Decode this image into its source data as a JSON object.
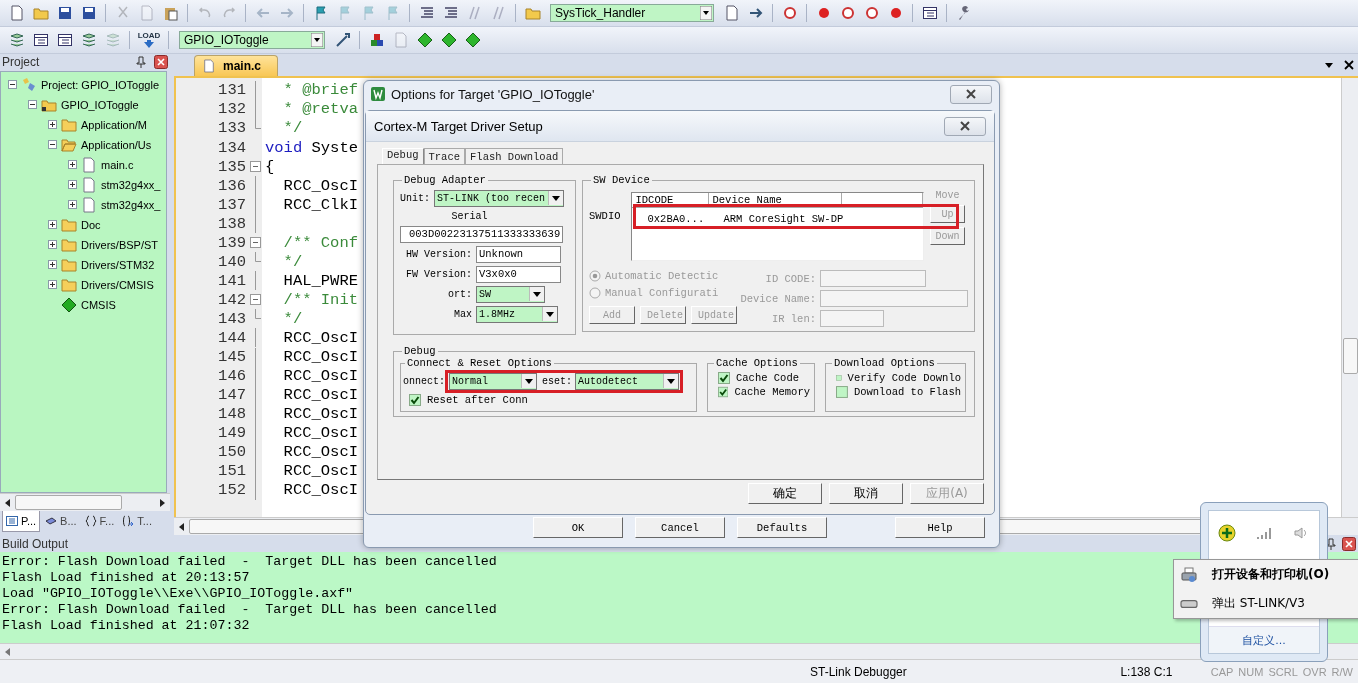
{
  "toolbar": {
    "function_combo": {
      "value": "SysTick_Handler"
    },
    "target_combo": {
      "value": "GPIO_IOToggle"
    },
    "load_label": "LOAD"
  },
  "project_panel": {
    "title": "Project",
    "tree": [
      {
        "label": "Project: GPIO_IOToggle",
        "kind": "project",
        "expanded": true,
        "children": [
          {
            "label": "GPIO_IOToggle",
            "kind": "target",
            "expanded": true,
            "children": [
              {
                "label": "Application/M",
                "kind": "group",
                "expanded": false
              },
              {
                "label": "Application/Us",
                "kind": "group",
                "expanded": true,
                "children": [
                  {
                    "label": "main.c",
                    "kind": "file",
                    "expanded": false
                  },
                  {
                    "label": "stm32g4xx_",
                    "kind": "file",
                    "expanded": false
                  },
                  {
                    "label": "stm32g4xx_",
                    "kind": "file",
                    "expanded": false
                  }
                ]
              },
              {
                "label": "Doc",
                "kind": "group",
                "expanded": false
              },
              {
                "label": "Drivers/BSP/ST",
                "kind": "group",
                "expanded": false
              },
              {
                "label": "Drivers/STM32",
                "kind": "group",
                "expanded": false
              },
              {
                "label": "Drivers/CMSIS",
                "kind": "group",
                "expanded": false
              },
              {
                "label": "CMSIS",
                "kind": "component"
              }
            ]
          }
        ]
      }
    ],
    "tabs": [
      {
        "label": "P...",
        "kind": "project",
        "selected": true
      },
      {
        "label": "B...",
        "kind": "books",
        "selected": false
      },
      {
        "label": "F...",
        "kind": "functions",
        "selected": false
      },
      {
        "label": "T...",
        "kind": "templates",
        "selected": false
      }
    ]
  },
  "editor": {
    "tabs": [
      {
        "label": "main.c",
        "selected": true
      }
    ],
    "lines": [
      {
        "num": "131",
        "kind": "fold_body",
        "tokens": [
          {
            "text": "  * @brief",
            "kind": "comment"
          }
        ]
      },
      {
        "num": "132",
        "kind": "fold_body",
        "tokens": [
          {
            "text": "  * @retva",
            "kind": "comment"
          }
        ]
      },
      {
        "num": "133",
        "kind": "fold_end",
        "tokens": [
          {
            "text": "  */",
            "kind": "comment"
          }
        ]
      },
      {
        "num": "134",
        "kind": "plain",
        "tokens": [
          {
            "text": "void",
            "kind": "keyword"
          },
          {
            "text": " Syste",
            "kind": "plain"
          }
        ]
      },
      {
        "num": "135",
        "kind": "fold_start",
        "tokens": [
          {
            "text": "{",
            "kind": "plain"
          }
        ]
      },
      {
        "num": "136",
        "kind": "fold_body",
        "tokens": [
          {
            "text": "  RCC_OscI",
            "kind": "plain"
          }
        ]
      },
      {
        "num": "137",
        "kind": "fold_body",
        "tokens": [
          {
            "text": "  RCC_ClkI",
            "kind": "plain"
          }
        ]
      },
      {
        "num": "138",
        "kind": "fold_body"
      },
      {
        "num": "139",
        "kind": "fold_start",
        "tokens": [
          {
            "text": "  /** Conf",
            "kind": "comment"
          }
        ]
      },
      {
        "num": "140",
        "kind": "fold_end",
        "tokens": [
          {
            "text": "  */",
            "kind": "comment"
          }
        ]
      },
      {
        "num": "141",
        "kind": "fold_body",
        "tokens": [
          {
            "text": "  HAL_PWRE",
            "kind": "plain"
          }
        ]
      },
      {
        "num": "142",
        "kind": "fold_start",
        "tokens": [
          {
            "text": "  /** Init",
            "kind": "comment"
          }
        ]
      },
      {
        "num": "143",
        "kind": "fold_end",
        "tokens": [
          {
            "text": "  */",
            "kind": "comment"
          }
        ]
      },
      {
        "num": "144",
        "kind": "fold_body",
        "tokens": [
          {
            "text": "  RCC_OscI",
            "kind": "plain"
          }
        ]
      },
      {
        "num": "145",
        "kind": "fold_body",
        "tokens": [
          {
            "text": "  RCC_OscI",
            "kind": "plain"
          }
        ]
      },
      {
        "num": "146",
        "kind": "fold_body",
        "tokens": [
          {
            "text": "  RCC_OscI",
            "kind": "plain"
          }
        ]
      },
      {
        "num": "147",
        "kind": "fold_body",
        "tokens": [
          {
            "text": "  RCC_OscI",
            "kind": "plain"
          }
        ]
      },
      {
        "num": "148",
        "kind": "fold_body",
        "tokens": [
          {
            "text": "  RCC_OscI",
            "kind": "plain"
          }
        ]
      },
      {
        "num": "149",
        "kind": "fold_body",
        "tokens": [
          {
            "text": "  RCC_OscI",
            "kind": "plain"
          }
        ]
      },
      {
        "num": "150",
        "kind": "fold_body",
        "tokens": [
          {
            "text": "  RCC_OscI",
            "kind": "plain"
          }
        ]
      },
      {
        "num": "151",
        "kind": "fold_body",
        "tokens": [
          {
            "text": "  RCC_OscI",
            "kind": "plain"
          }
        ]
      },
      {
        "num": "152",
        "kind": "fold_body",
        "tokens": [
          {
            "text": "  RCC_OscI",
            "kind": "plain"
          }
        ]
      }
    ]
  },
  "options_dialog": {
    "title": "Options for Target 'GPIO_IOToggle'",
    "buttons": [
      {
        "label": "OK"
      },
      {
        "label": "Cancel"
      },
      {
        "label": "Defaults"
      },
      {
        "label": "Help"
      }
    ]
  },
  "driver_dialog": {
    "title": "Cortex-M Target Driver Setup",
    "tabs": [
      {
        "label": "Debug",
        "selected": true
      },
      {
        "label": "Trace",
        "selected": false
      },
      {
        "label": "Flash Download",
        "selected": false
      }
    ],
    "debug_adapter": {
      "title": "Debug Adapter",
      "unit_label": "Unit:",
      "unit": "ST-LINK (too recen",
      "serial_label": "Serial",
      "serial": "003D00223137511333333639",
      "hw_label": "HW Version:",
      "hw": "Unknown",
      "fw_label": "FW Version:",
      "fw": "V3x0x0",
      "port_label": "ort:",
      "port": "SW",
      "max_label": "Max",
      "max": "1.8MHz"
    },
    "sw_device": {
      "title": "SW Device",
      "swdio_label": "SWDIO",
      "columns": [
        "IDCODE",
        "Device Name"
      ],
      "rows": [
        {
          "idcode": "0x2BA0...",
          "name": "ARM CoreSight SW-DP",
          "highlighted": true
        }
      ],
      "move_label": "Move",
      "up": "Up",
      "down": "Down",
      "disabled": true,
      "modes": [
        {
          "label": "Automatic Detectic",
          "selected": true
        },
        {
          "label": "Manual Configurati",
          "selected": false
        }
      ],
      "buttons": [
        "Add",
        "Delete",
        "Update"
      ],
      "id_code_label": "ID CODE:",
      "device_name_label": "Device Name:",
      "ir_len_label": "IR len:"
    },
    "debug": {
      "title": "Debug",
      "connect_reset": {
        "title": "Connect & Reset Options",
        "connect_label": "onnect:",
        "connect": "Normal",
        "reset_label": "eset:",
        "reset": "Autodetect",
        "highlighted": true,
        "reset_after_connect": {
          "label": "Reset after Conn",
          "checked": true
        }
      },
      "cache": {
        "title": "Cache Options",
        "options": [
          {
            "label": "Cache Code",
            "checked": true
          },
          {
            "label": "Cache Memory",
            "checked": true
          }
        ]
      },
      "download": {
        "title": "Download Options",
        "options": [
          {
            "label": "Verify Code Downlo",
            "checked": false
          },
          {
            "label": "Download to Flash",
            "checked": false
          }
        ]
      }
    },
    "buttons": [
      {
        "label": "确定",
        "disabled": false
      },
      {
        "label": "取消",
        "disabled": false
      },
      {
        "label": "应用(A)",
        "disabled": true
      }
    ]
  },
  "build_output": {
    "title": "Build Output",
    "lines": [
      "Error: Flash Download failed  -  Target DLL has been cancelled",
      "Flash Load finished at 20:13:57",
      "Load \"GPIO_IOToggle\\\\Exe\\\\GPIO_IOToggle.axf\"",
      "Error: Flash Download failed  -  Target DLL has been cancelled",
      "Flash Load finished at 21:07:32"
    ]
  },
  "status_bar": {
    "debugger": "ST-Link Debugger",
    "position": "L:138 C:1",
    "indicators": [
      {
        "label": "CAP",
        "on": false
      },
      {
        "label": "NUM",
        "on": false
      },
      {
        "label": "SCRL",
        "on": false
      },
      {
        "label": "OVR",
        "on": false
      },
      {
        "label": "R/W",
        "on": false
      }
    ]
  },
  "tray_popup": {
    "customize_link": "自定义...",
    "menu": [
      {
        "label": "打开设备和打印机(O)",
        "kind": "printer",
        "default": true
      },
      {
        "label": "弹出 ST-LINK/V3",
        "kind": "drive",
        "default": false
      }
    ]
  }
}
